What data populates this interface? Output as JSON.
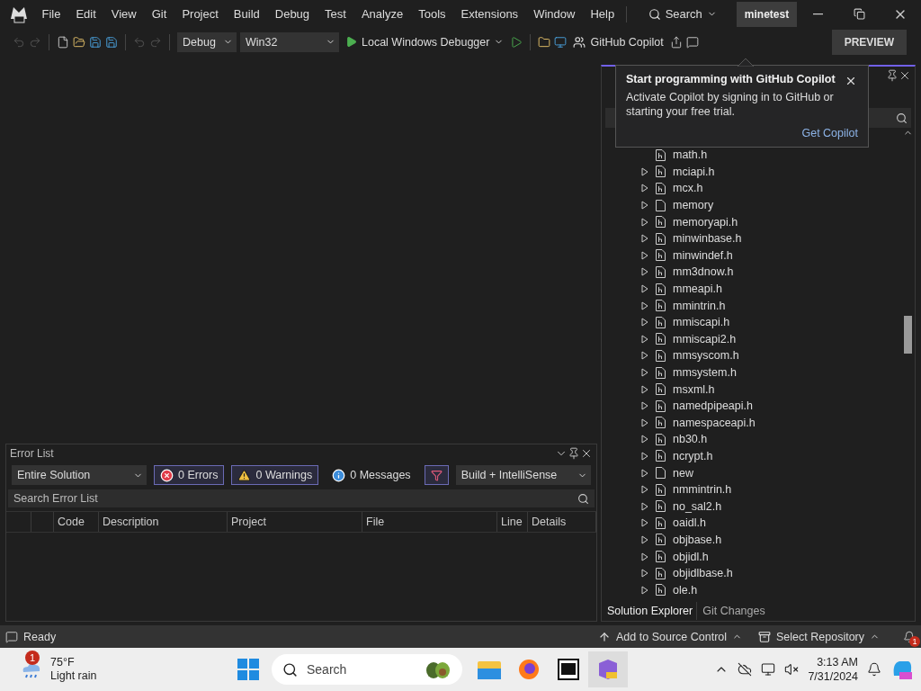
{
  "menu": {
    "items": [
      "File",
      "Edit",
      "View",
      "Git",
      "Project",
      "Build",
      "Debug",
      "Test",
      "Analyze",
      "Tools",
      "Extensions",
      "Window",
      "Help"
    ],
    "search": "Search",
    "solution": "minetest"
  },
  "toolbar": {
    "configuration": "Debug",
    "platform": "Win32",
    "debugger": "Local Windows Debugger",
    "copilot": "GitHub Copilot",
    "preview": "PREVIEW"
  },
  "copilot_popup": {
    "title": "Start programming with GitHub Copilot",
    "body": "Activate Copilot by signing in to GitHub or starting your free trial.",
    "link": "Get Copilot"
  },
  "solution_explorer": {
    "items": [
      {
        "name": "math.h",
        "kind": "header",
        "expandable": false
      },
      {
        "name": "mciapi.h",
        "kind": "header",
        "expandable": true
      },
      {
        "name": "mcx.h",
        "kind": "header",
        "expandable": true
      },
      {
        "name": "memory",
        "kind": "file",
        "expandable": true
      },
      {
        "name": "memoryapi.h",
        "kind": "header",
        "expandable": true
      },
      {
        "name": "minwinbase.h",
        "kind": "header",
        "expandable": true
      },
      {
        "name": "minwindef.h",
        "kind": "header",
        "expandable": true
      },
      {
        "name": "mm3dnow.h",
        "kind": "header",
        "expandable": true
      },
      {
        "name": "mmeapi.h",
        "kind": "header",
        "expandable": true
      },
      {
        "name": "mmintrin.h",
        "kind": "header",
        "expandable": true
      },
      {
        "name": "mmiscapi.h",
        "kind": "header",
        "expandable": true
      },
      {
        "name": "mmiscapi2.h",
        "kind": "header",
        "expandable": true
      },
      {
        "name": "mmsyscom.h",
        "kind": "header",
        "expandable": true
      },
      {
        "name": "mmsystem.h",
        "kind": "header",
        "expandable": true
      },
      {
        "name": "msxml.h",
        "kind": "header",
        "expandable": true
      },
      {
        "name": "namedpipeapi.h",
        "kind": "header",
        "expandable": true
      },
      {
        "name": "namespaceapi.h",
        "kind": "header",
        "expandable": true
      },
      {
        "name": "nb30.h",
        "kind": "header",
        "expandable": true
      },
      {
        "name": "ncrypt.h",
        "kind": "header",
        "expandable": true
      },
      {
        "name": "new",
        "kind": "file",
        "expandable": true
      },
      {
        "name": "nmmintrin.h",
        "kind": "header",
        "expandable": true
      },
      {
        "name": "no_sal2.h",
        "kind": "header",
        "expandable": true
      },
      {
        "name": "oaidl.h",
        "kind": "header",
        "expandable": true
      },
      {
        "name": "objbase.h",
        "kind": "header",
        "expandable": true
      },
      {
        "name": "objidl.h",
        "kind": "header",
        "expandable": true
      },
      {
        "name": "objidlbase.h",
        "kind": "header",
        "expandable": true
      },
      {
        "name": "ole.h",
        "kind": "header",
        "expandable": true
      }
    ],
    "tabs": [
      {
        "label": "Solution Explorer",
        "selected": true
      },
      {
        "label": "Git Changes",
        "selected": false
      }
    ]
  },
  "error_list": {
    "title": "Error List",
    "scope": "Entire Solution",
    "filters": [
      {
        "kind": "errors",
        "label": "0 Errors",
        "selected": true
      },
      {
        "kind": "warnings",
        "label": "0 Warnings",
        "selected": true
      },
      {
        "kind": "messages",
        "label": "0 Messages",
        "selected": false
      }
    ],
    "build_filter": "Build + IntelliSense",
    "search_placeholder": "Search Error List",
    "columns": [
      "Code",
      "Description",
      "Project",
      "File",
      "Line",
      "Details"
    ]
  },
  "status_bar": {
    "status": "Ready",
    "source_control": "Add to Source Control",
    "repository": "Select Repository",
    "notifications": "1"
  },
  "taskbar": {
    "weather_badge": "1",
    "temperature": "75°F",
    "condition": "Light rain",
    "search_placeholder": "Search",
    "time": "3:13 AM",
    "date": "7/31/2024"
  }
}
